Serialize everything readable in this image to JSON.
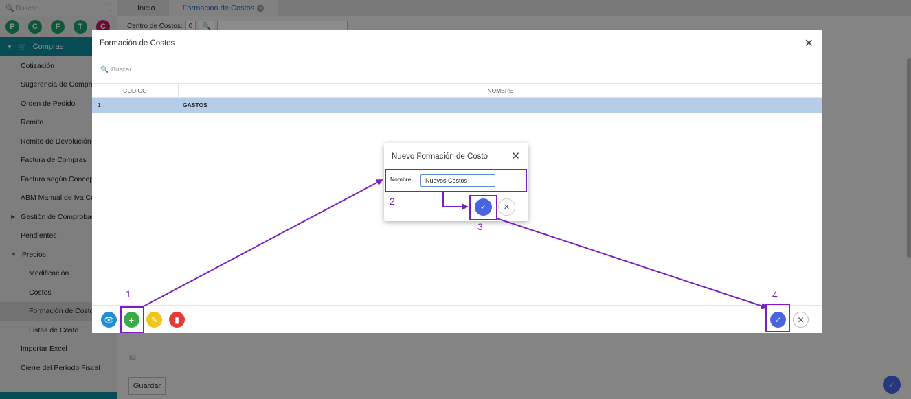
{
  "sidebar": {
    "search_placeholder": "Buscar...",
    "expand_icon": "expand-icon",
    "circles": [
      {
        "letter": "P",
        "color": "#1aa06b"
      },
      {
        "letter": "C",
        "color": "#1aa06b"
      },
      {
        "letter": "F",
        "color": "#1aa06b"
      },
      {
        "letter": "T",
        "color": "#1aa06b"
      },
      {
        "letter": "C",
        "color": "#c2185b"
      }
    ],
    "section": "Compras",
    "items": [
      "Cotización",
      "Sugerencia de Compra",
      "Orden de Pedido",
      "Remito",
      "Remito de Devolución",
      "Factura de Compras",
      "Factura según Concepto",
      "ABM Manual de Iva Compras",
      "Gestión de Comprobantes",
      "Pendientes",
      "Precios",
      "Modificación",
      "Costos",
      "Formación de Costos",
      "Listas de Costo",
      "Importar Excel",
      "Cierre del Período Fiscal"
    ]
  },
  "tabs": {
    "home": "Inicio",
    "active": "Formación de Costos"
  },
  "background": {
    "filter_label": "Centro de Costos:",
    "filter_value": "0",
    "count": "53",
    "save_label": "Guardar"
  },
  "modal": {
    "title": "Formación de Costos",
    "search_placeholder": "Buscar...",
    "columns": [
      "CODIGO",
      "NOMBRE"
    ],
    "rows": [
      {
        "codigo": "1",
        "nombre": "GASTOS"
      }
    ]
  },
  "dialog": {
    "title": "Nuevo Formación de Costo",
    "label": "Nombre:",
    "value": "Nuevos Costos"
  },
  "annotations": {
    "n1": "1",
    "n2": "2",
    "n3": "3",
    "n4": "4",
    "color": "#7a1fc0"
  }
}
